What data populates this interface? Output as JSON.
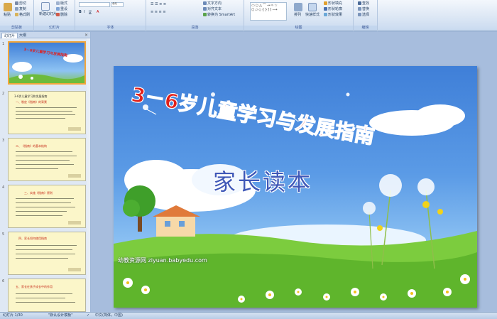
{
  "ribbon": {
    "clipboard": {
      "paste": "粘贴",
      "cut": "剪切",
      "copy": "复制",
      "format_painter": "格式刷",
      "label": "剪贴板"
    },
    "slides": {
      "new_slide": "新建幻灯片",
      "layout": "版式",
      "reset": "重设",
      "delete": "删除",
      "label": "幻灯片"
    },
    "font": {
      "size": "44",
      "label": "字体"
    },
    "paragraph": {
      "text_direction": "文字方向",
      "align_text": "对齐文本",
      "smartart": "转换为 SmartArt",
      "label": "段落"
    },
    "drawing": {
      "arrange": "排列",
      "quick_styles": "快速样式",
      "shape_fill": "形状填充",
      "shape_outline": "形状轮廓",
      "shape_effects": "形状效果",
      "label": "绘图"
    },
    "editing": {
      "find": "查找",
      "replace": "替换",
      "select": "选择",
      "label": "编辑"
    }
  },
  "left_panel": {
    "tab_slides": "幻灯片",
    "tab_outline": "大纲",
    "close": "×",
    "thumbnails": [
      {
        "num": "1",
        "title": "3－6岁儿童学习与发展指南"
      },
      {
        "num": "2",
        "title": "3-6岁儿童学习和发展指南",
        "head": "一、制定《指南》的背景"
      },
      {
        "num": "3",
        "title": "",
        "head": "二、《指南》的基本结构"
      },
      {
        "num": "4",
        "title": "",
        "head": "三、实施《指南》原则"
      },
      {
        "num": "5",
        "title": "",
        "head": "四、家长如何使用指南"
      },
      {
        "num": "6",
        "title": "",
        "head": "五、家长在孩子成长中的作用"
      }
    ]
  },
  "slide": {
    "title": "3－6岁儿童学习与发展指南",
    "subtitle": "家长读本",
    "watermark": "幼教资源网 ziyuan.babyedu.com"
  },
  "status": {
    "slide_count": "幻灯片 1/30",
    "theme": "\"默认设计模板\"",
    "language": "中文(简体，中国)"
  }
}
